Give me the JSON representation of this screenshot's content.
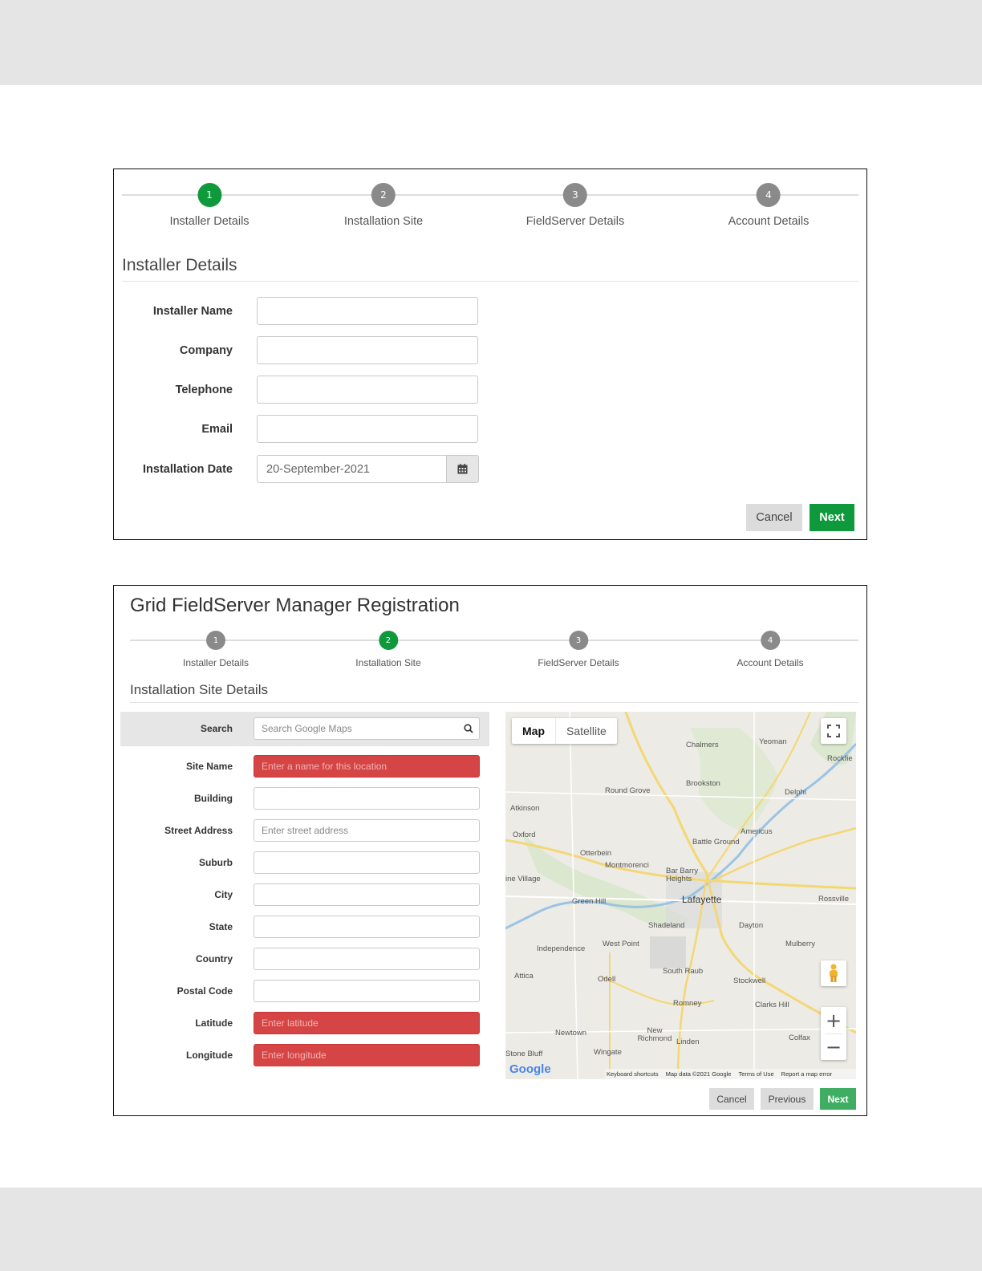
{
  "steps": [
    {
      "num": "1",
      "label": "Installer Details"
    },
    {
      "num": "2",
      "label": "Installation Site"
    },
    {
      "num": "3",
      "label": "FieldServer Details"
    },
    {
      "num": "4",
      "label": "Account Details"
    }
  ],
  "panel1": {
    "active_step": 1,
    "section_title": "Installer Details",
    "fields": {
      "installer_name": {
        "label": "Installer Name",
        "value": ""
      },
      "company": {
        "label": "Company",
        "value": ""
      },
      "telephone": {
        "label": "Telephone",
        "value": ""
      },
      "email": {
        "label": "Email",
        "value": ""
      },
      "installation_date": {
        "label": "Installation Date",
        "value": "20-September-2021"
      }
    },
    "icons": {
      "date_picker": "calendar-icon"
    },
    "buttons": {
      "cancel": "Cancel",
      "next": "Next"
    }
  },
  "panel2": {
    "title": "Grid FieldServer Manager Registration",
    "active_step": 2,
    "section_title": "Installation Site Details",
    "search": {
      "label": "Search",
      "placeholder": "Search Google Maps"
    },
    "fields": {
      "site_name": {
        "label": "Site Name",
        "placeholder": "Enter a name for this location",
        "error": true
      },
      "building": {
        "label": "Building",
        "placeholder": ""
      },
      "street_address": {
        "label": "Street Address",
        "placeholder": "Enter street address"
      },
      "suburb": {
        "label": "Suburb",
        "placeholder": ""
      },
      "city": {
        "label": "City",
        "placeholder": ""
      },
      "state": {
        "label": "State",
        "placeholder": ""
      },
      "country": {
        "label": "Country",
        "placeholder": ""
      },
      "postal_code": {
        "label": "Postal Code",
        "placeholder": ""
      },
      "latitude": {
        "label": "Latitude",
        "placeholder": "Enter latitude",
        "error": true
      },
      "longitude": {
        "label": "Longitude",
        "placeholder": "Enter longitude",
        "error": true
      }
    },
    "map": {
      "tabs": {
        "map": "Map",
        "satellite": "Satellite"
      },
      "places": [
        "Chalmers",
        "Yeoman",
        "Brookston",
        "Round Grove",
        "Delphi",
        "Atkinson",
        "Oxford",
        "Americus",
        "Battle Ground",
        "Otterbein",
        "Montmorenci",
        "Bar Barry Heights",
        "Lafayette",
        "Green Hill",
        "Shadeland",
        "Dayton",
        "West Point",
        "Independence",
        "Mulberry",
        "South Raub",
        "Stockwell",
        "Attica",
        "Odell",
        "Romney",
        "Clarks Hill",
        "Newtown",
        "New Richmond",
        "Linden",
        "Colfax",
        "Wingate",
        "Rossville",
        "Rockfie",
        "ine Village",
        "Stone Bluff"
      ],
      "attribution": {
        "logo": "Google",
        "shortcuts": "Keyboard shortcuts",
        "data": "Map data ©2021 Google",
        "terms": "Terms of Use",
        "report": "Report a map error"
      },
      "controls": {
        "zoom_in": "+",
        "zoom_out": "−"
      }
    },
    "buttons": {
      "cancel": "Cancel",
      "previous": "Previous",
      "next": "Next"
    }
  }
}
